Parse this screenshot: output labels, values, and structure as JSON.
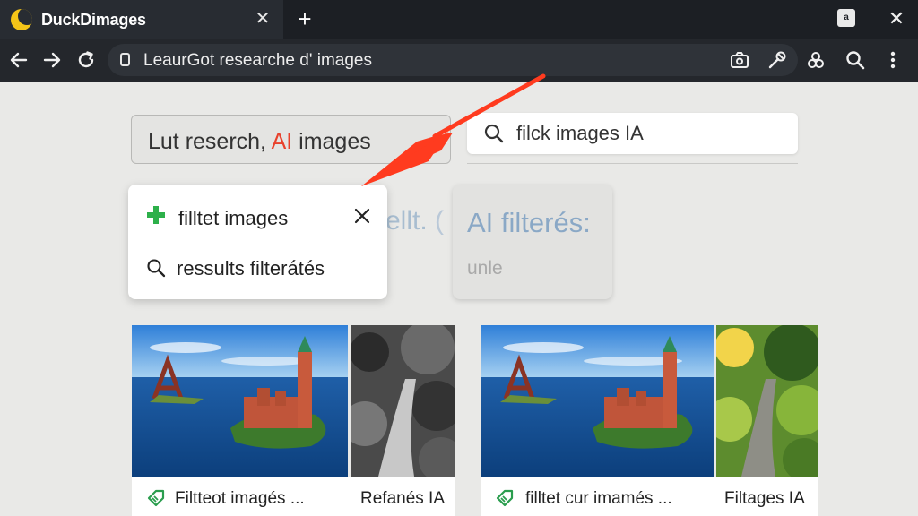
{
  "browser": {
    "tab_title": "DuckDimages",
    "address": "LeaurGot researche d' images",
    "win_icon_glyph": "a"
  },
  "icons": [
    "duck-logo-icon",
    "close-icon",
    "plus-icon",
    "back-arrow-icon",
    "forward-arrow-icon",
    "reload-icon",
    "lock-icon",
    "camera-icon",
    "extensions-icon",
    "profile-icon",
    "search-icon",
    "menu-dots-icon",
    "tag-icon"
  ],
  "colors": {
    "accent_red": "#e8412c",
    "plus_green": "#2db04a",
    "tag_green": "#2a9d4e",
    "faded_blue": "#8aa8c6"
  },
  "search": {
    "left_prefix": "Lut reserch, ",
    "left_ai": "AI",
    "left_suffix": " images",
    "right_query": "filck images IA"
  },
  "dropdown": {
    "item1": "filltet images",
    "item2": "ressults filterátés"
  },
  "faded_text": "ellt. ",
  "ai_card": {
    "heading": "AI filterés:",
    "sub": "unle"
  },
  "results": [
    {
      "caption": "Filtteot imagés ..."
    },
    {
      "caption": "Refanés IA"
    },
    {
      "caption": "filltet cur imamés ..."
    },
    {
      "caption": "Filtages IA"
    }
  ]
}
